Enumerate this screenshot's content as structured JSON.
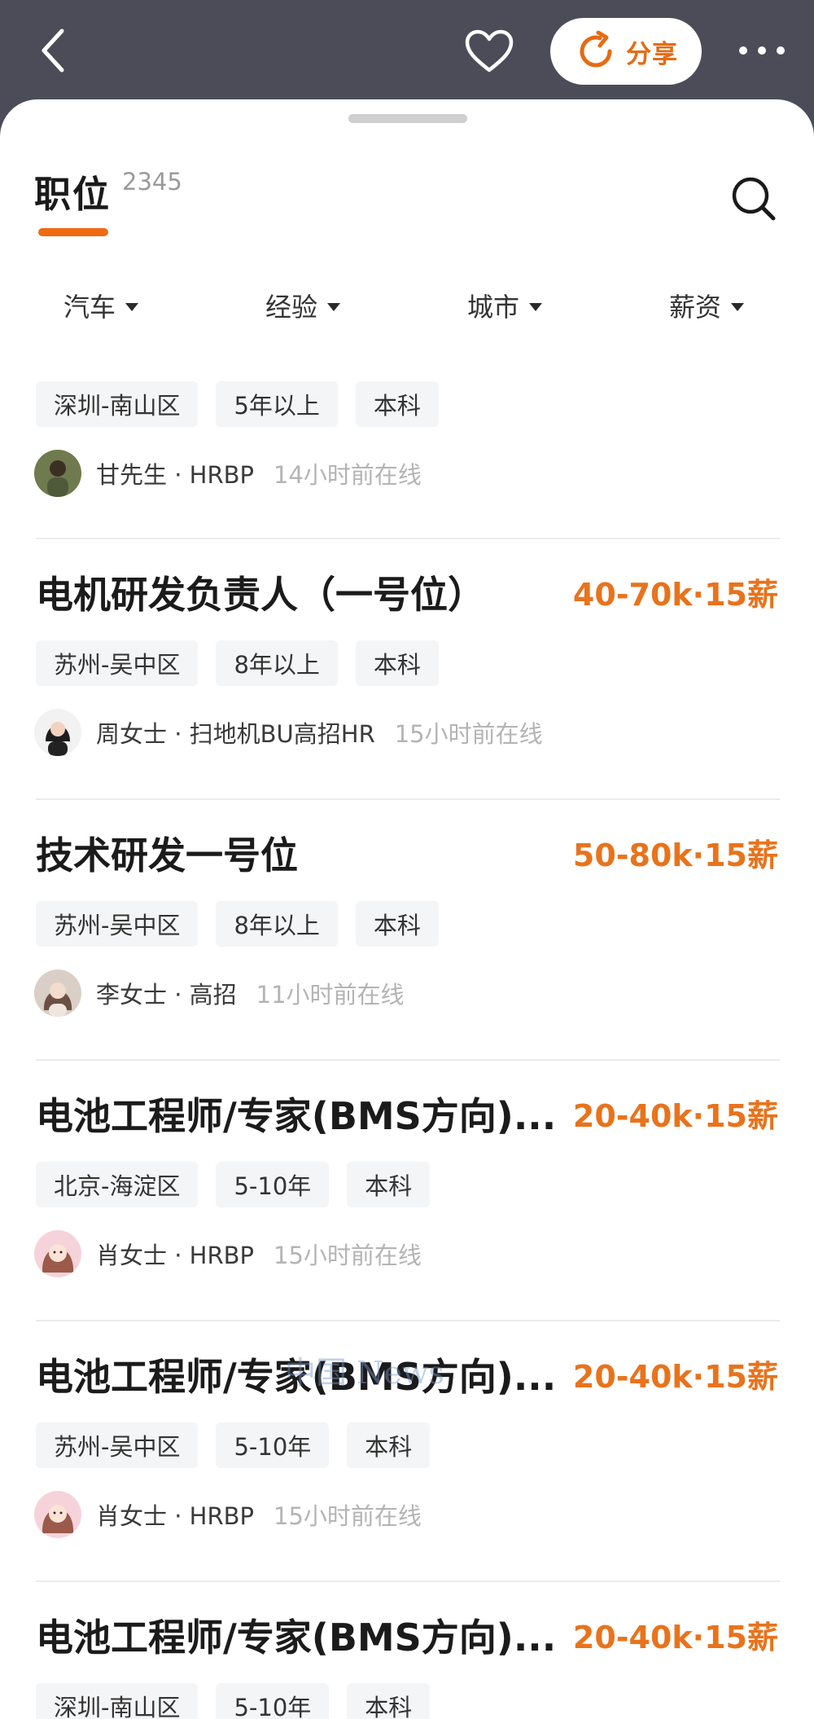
{
  "header": {
    "share_label": "分享",
    "icons": [
      "back-icon",
      "heart-icon",
      "share-refresh-icon",
      "more-icon"
    ]
  },
  "tabs": {
    "active_label": "职位",
    "count": "2345"
  },
  "filters": [
    {
      "label": "汽车"
    },
    {
      "label": "经验"
    },
    {
      "label": "城市"
    },
    {
      "label": "薪资"
    }
  ],
  "jobs": [
    {
      "title": "",
      "salary": "",
      "tags": [
        "深圳-南山区",
        "5年以上",
        "本科"
      ],
      "recruiter": "甘先生 · HRBP",
      "status": "14小时前在线"
    },
    {
      "title": "电机研发负责人（一号位）",
      "salary": "40-70k·15薪",
      "tags": [
        "苏州-吴中区",
        "8年以上",
        "本科"
      ],
      "recruiter": "周女士 · 扫地机BU高招HR",
      "status": "15小时前在线"
    },
    {
      "title": "技术研发一号位",
      "salary": "50-80k·15薪",
      "tags": [
        "苏州-吴中区",
        "8年以上",
        "本科"
      ],
      "recruiter": "李女士 · 高招",
      "status": "11小时前在线"
    },
    {
      "title": "电池工程师/专家(BMS方向)...",
      "salary": "20-40k·15薪",
      "tags": [
        "北京-海淀区",
        "5-10年",
        "本科"
      ],
      "recruiter": "肖女士 · HRBP",
      "status": "15小时前在线"
    },
    {
      "title": "电池工程师/专家(BMS方向)...",
      "salary": "20-40k·15薪",
      "tags": [
        "苏州-吴中区",
        "5-10年",
        "本科"
      ],
      "recruiter": "肖女士 · HRBP",
      "status": "15小时前在线"
    },
    {
      "title": "电池工程师/专家(BMS方向)...",
      "salary": "20-40k·15薪",
      "tags": [
        "深圳-南山区",
        "5-10年",
        "本科"
      ],
      "recruiter": "",
      "status": ""
    }
  ],
  "watermark": "中国 News",
  "colors": {
    "accent": "#e8731c",
    "header_bg": "#4b4c58",
    "tag_bg": "#f4f5f6"
  }
}
